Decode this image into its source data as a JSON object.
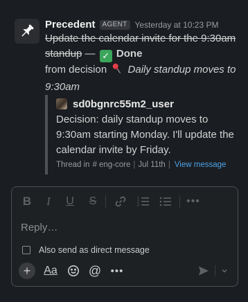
{
  "message": {
    "sender": "Precedent",
    "badge": "AGENT",
    "timestamp": "Yesterday at 10:23 PM",
    "struck_text": "Update the calendar invite for the 9:30am standup",
    "dash": " — ",
    "done_label": "Done",
    "from_decision_prefix": "from decision",
    "decision_title": "Daily standup moves to 9:30am"
  },
  "quoted": {
    "username": "sd0bgnrc55m2_user",
    "text": "Decision: daily standup moves to 9:30am starting Monday. I'll update the calendar invite by Friday.",
    "thread_in": "Thread in",
    "channel_hash": "#",
    "channel": "eng-core",
    "date": "Jul 11th",
    "view_link": "View message"
  },
  "composer": {
    "placeholder": "Reply…",
    "also_send_label": "Also send as direct message",
    "checkbox_checked": false
  },
  "colors": {
    "background": "#1a1d21",
    "link": "#4ea4e8",
    "done_check": "#3ba55c",
    "pin": "#e0404a"
  },
  "icons": {
    "app_avatar": "pushpin-icon",
    "format_toolbar": [
      "bold-icon",
      "italic-icon",
      "underline-icon",
      "strikethrough-icon",
      "link-icon",
      "ordered-list-icon",
      "bullet-list-icon",
      "more-icon"
    ],
    "bottom_toolbar": [
      "plus-icon",
      "text-format-icon",
      "emoji-icon",
      "mention-icon",
      "more-icon",
      "send-icon",
      "chevron-down-icon"
    ]
  }
}
